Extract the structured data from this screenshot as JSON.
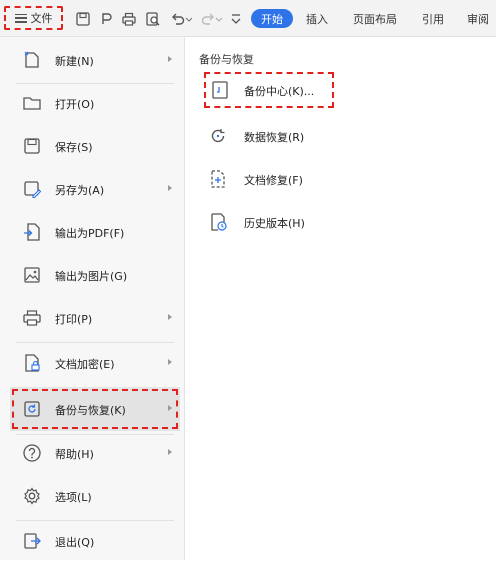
{
  "toolbar": {
    "file_label": "文件",
    "start_label": "开始",
    "tabs": [
      "插入",
      "页面布局",
      "引用",
      "审阅"
    ],
    "icons": [
      "save-icon",
      "export-icon",
      "print-icon",
      "print-preview-icon",
      "undo-icon",
      "undo-dropdown-icon",
      "redo-icon",
      "redo-dropdown-icon",
      "more-icon"
    ]
  },
  "left_menu": {
    "items": [
      {
        "label": "新建(N)",
        "icon": "new-document-icon",
        "has_submenu": true
      },
      {
        "label": "打开(O)",
        "icon": "folder-icon",
        "has_submenu": false
      },
      {
        "label": "保存(S)",
        "icon": "save-icon",
        "has_submenu": false
      },
      {
        "label": "另存为(A)",
        "icon": "save-as-icon",
        "has_submenu": true
      },
      {
        "label": "输出为PDF(F)",
        "icon": "pdf-export-icon",
        "has_submenu": false
      },
      {
        "label": "输出为图片(G)",
        "icon": "image-export-icon",
        "has_submenu": false
      },
      {
        "label": "打印(P)",
        "icon": "print-icon",
        "has_submenu": true
      },
      {
        "label": "文档加密(E)",
        "icon": "encrypt-document-icon",
        "has_submenu": true
      },
      {
        "label": "备份与恢复(K)",
        "icon": "backup-restore-icon",
        "has_submenu": true
      },
      {
        "label": "帮助(H)",
        "icon": "help-icon",
        "has_submenu": true
      },
      {
        "label": "选项(L)",
        "icon": "settings-icon",
        "has_submenu": false
      },
      {
        "label": "退出(Q)",
        "icon": "exit-icon",
        "has_submenu": false
      }
    ]
  },
  "submenu": {
    "title": "备份与恢复",
    "items": [
      {
        "label": "备份中心(K)...",
        "icon": "backup-center-icon"
      },
      {
        "label": "数据恢复(R)",
        "icon": "data-recovery-icon"
      },
      {
        "label": "文档修复(F)",
        "icon": "document-repair-icon"
      },
      {
        "label": "历史版本(H)",
        "icon": "history-version-icon"
      }
    ]
  },
  "colors": {
    "accent": "#2e73e8",
    "highlight_dash": "#e0221c",
    "menu_bg": "#f7f7f7",
    "active_bg": "#e3e3e3"
  }
}
